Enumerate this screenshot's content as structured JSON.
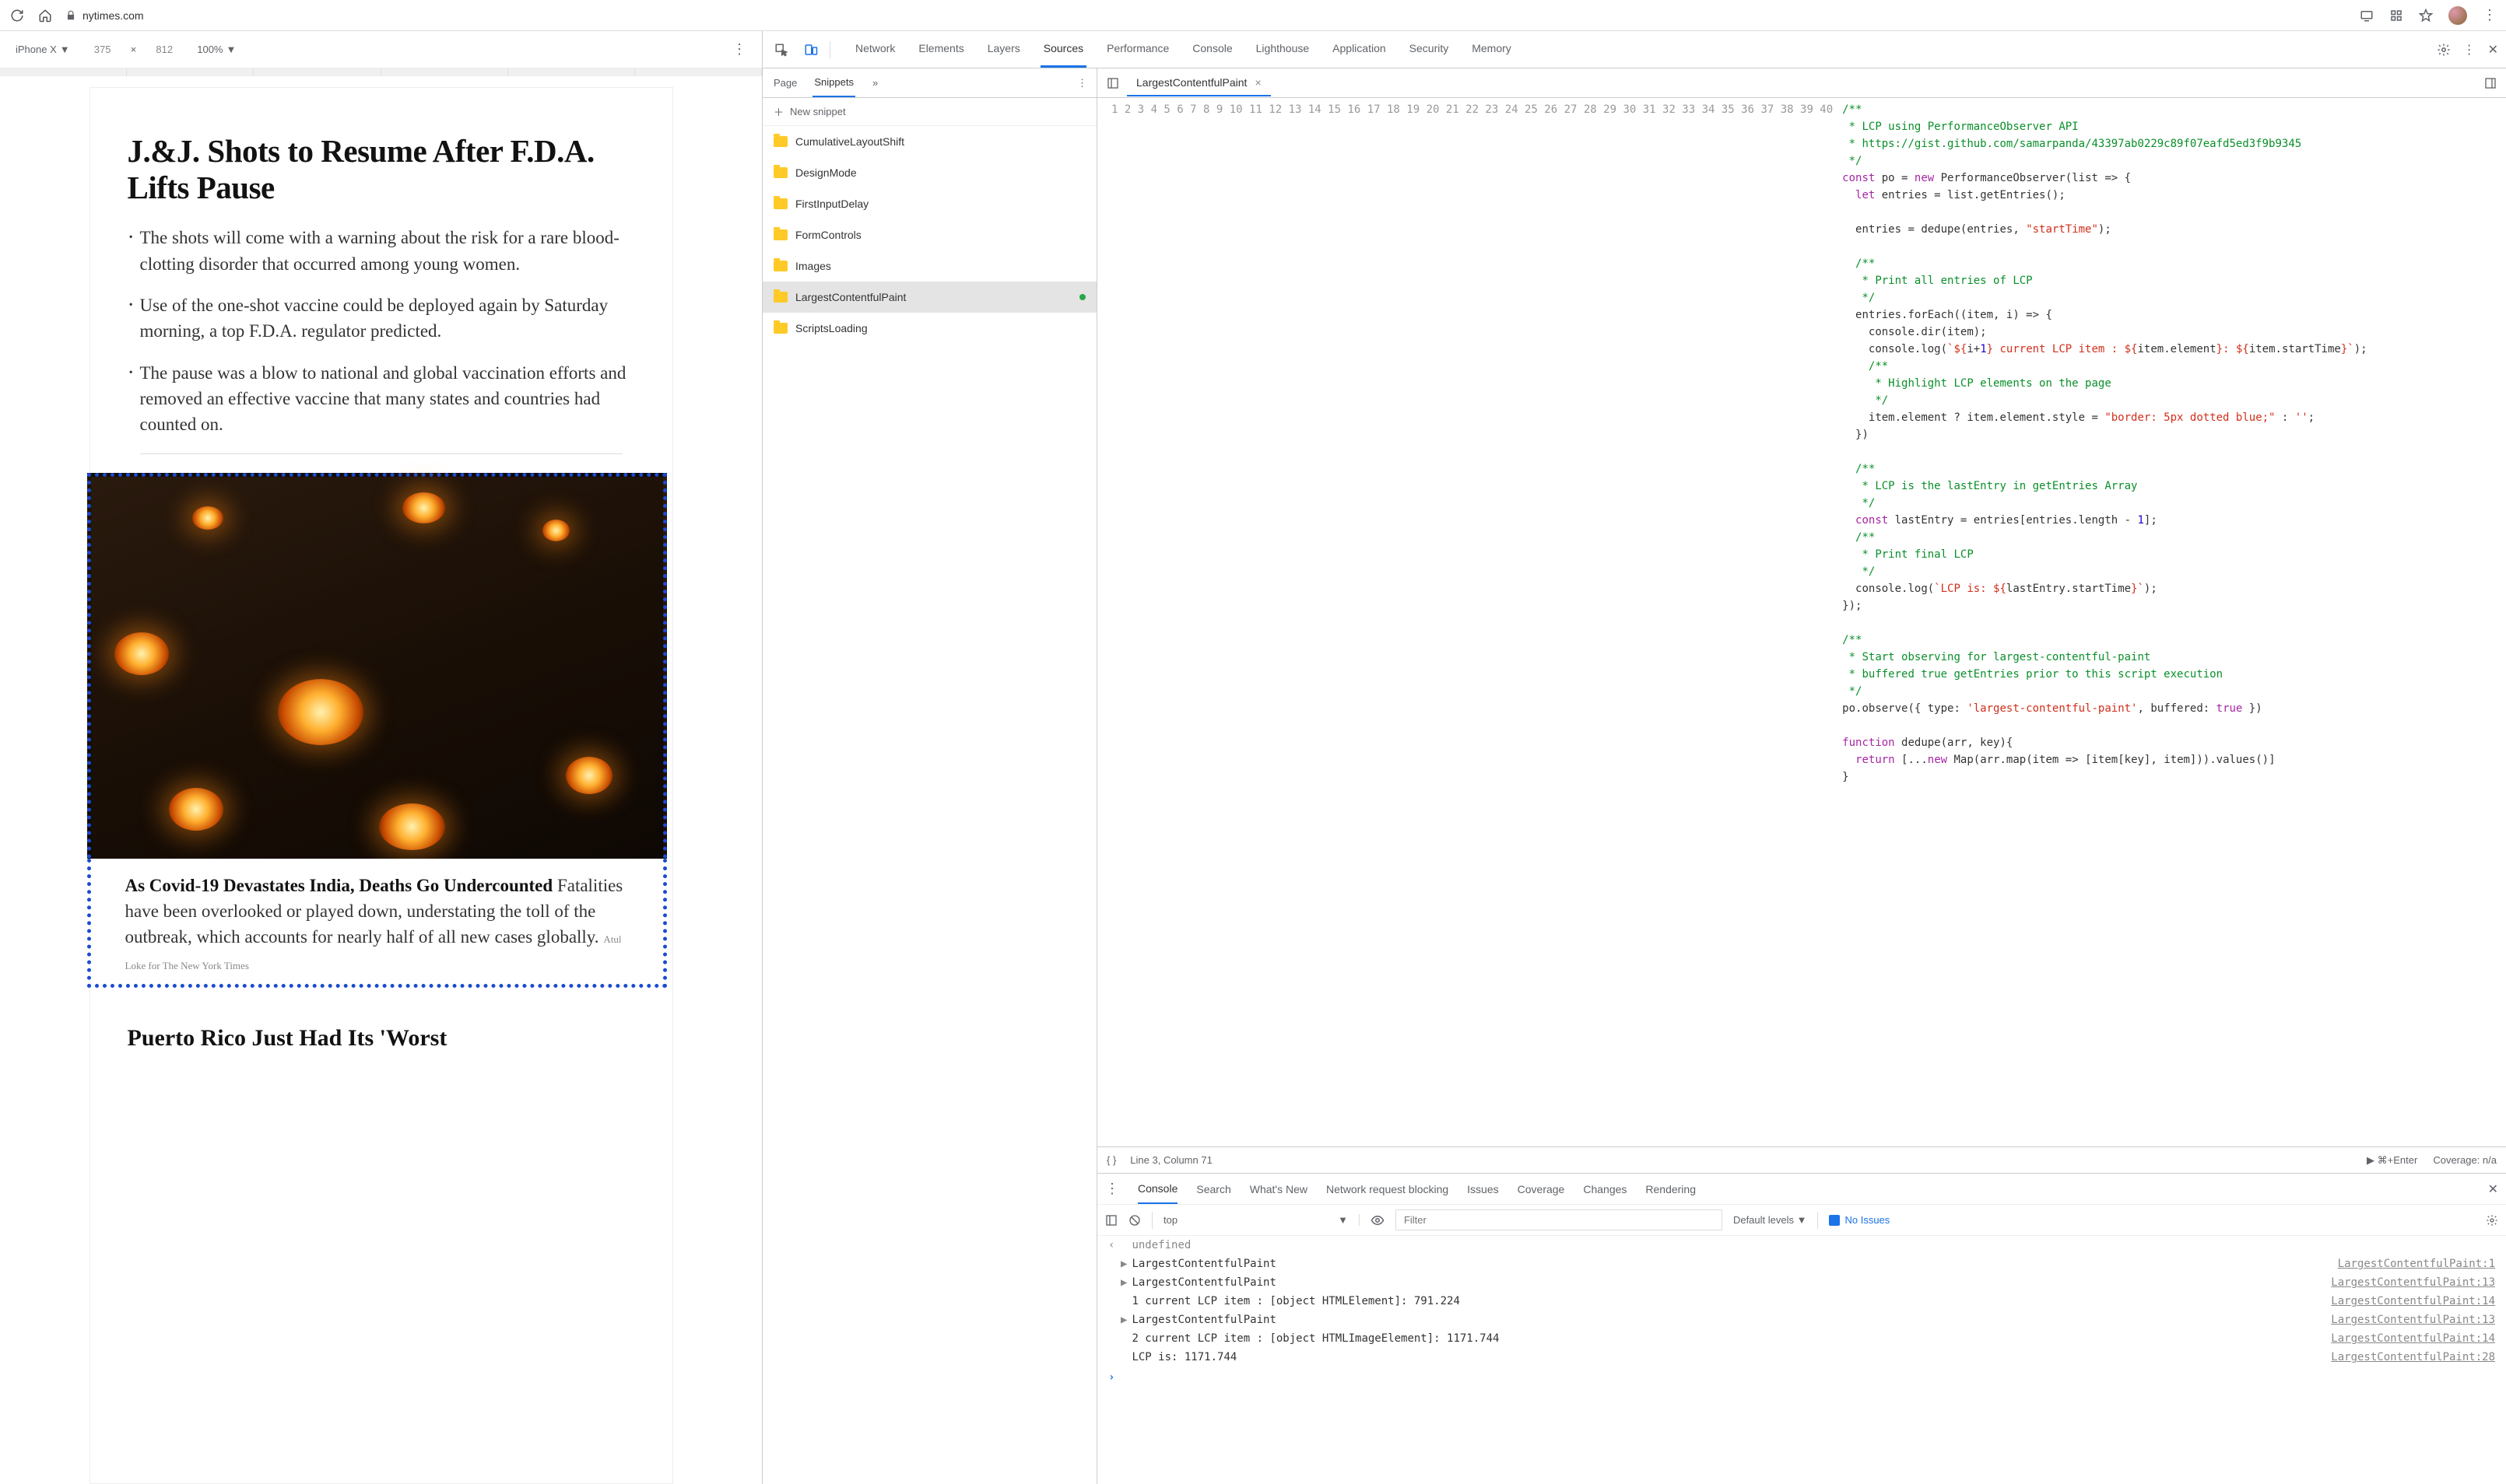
{
  "browser": {
    "url": "nytimes.com"
  },
  "device_bar": {
    "device": "iPhone X",
    "width": "375",
    "height": "812",
    "zoom": "100%"
  },
  "article": {
    "headline": "J.&J. Shots to Resume After F.D.A. Lifts Pause",
    "bullets": [
      "The shots will come with a warning about the risk for a rare blood-clotting disorder that occurred among young women.",
      "Use of the one-shot vaccine could be deployed again by Saturday morning, a top F.D.A. regulator predicted.",
      "The pause was a blow to national and global vaccination efforts and removed an effective vaccine that many states and countries had counted on."
    ],
    "story2_title": "As Covid-19 Devastates India, Deaths Go Undercounted",
    "story2_body": " Fatalities have been overlooked or played down, understating the toll of the outbreak, which accounts for nearly half of all new cases globally. ",
    "story2_credit": "Atul Loke for The New York Times",
    "next_headline": "Puerto Rico Just Had Its 'Worst"
  },
  "devtools": {
    "tabs": [
      "Network",
      "Elements",
      "Layers",
      "Sources",
      "Performance",
      "Console",
      "Lighthouse",
      "Application",
      "Security",
      "Memory"
    ],
    "active_tab": "Sources",
    "snippets_tabs": {
      "page": "Page",
      "snippets": "Snippets"
    },
    "new_snippet": "New snippet",
    "snippets": [
      "CumulativeLayoutShift",
      "DesignMode",
      "FirstInputDelay",
      "FormControls",
      "Images",
      "LargestContentfulPaint",
      "ScriptsLoading"
    ],
    "selected_snippet": "LargestContentfulPaint",
    "file_tab": "LargestContentfulPaint",
    "code_lines": 40,
    "status": {
      "cursor": "Line 3, Column 71",
      "hint": "⌘+Enter",
      "coverage": "Coverage: n/a"
    },
    "console_tabs": [
      "Console",
      "Search",
      "What's New",
      "Network request blocking",
      "Issues",
      "Coverage",
      "Changes",
      "Rendering"
    ],
    "console_context": "top",
    "filter_placeholder": "Filter",
    "levels": "Default levels",
    "no_issues": "No Issues",
    "console_output": [
      {
        "type": "undef",
        "msg": "undefined"
      },
      {
        "type": "obj",
        "msg": "LargestContentfulPaint",
        "src": "LargestContentfulPaint:1"
      },
      {
        "type": "obj",
        "msg": "LargestContentfulPaint",
        "src": "LargestContentfulPaint:13"
      },
      {
        "type": "log",
        "msg": "1 current LCP item : [object HTMLElement]: 791.224",
        "src": "LargestContentfulPaint:14"
      },
      {
        "type": "obj",
        "msg": "LargestContentfulPaint",
        "src": "LargestContentfulPaint:13"
      },
      {
        "type": "log",
        "msg": "2 current LCP item : [object HTMLImageElement]: 1171.744",
        "src": "LargestContentfulPaint:14"
      },
      {
        "type": "log",
        "msg": "LCP is: 1171.744",
        "src": "LargestContentfulPaint:28"
      }
    ]
  }
}
